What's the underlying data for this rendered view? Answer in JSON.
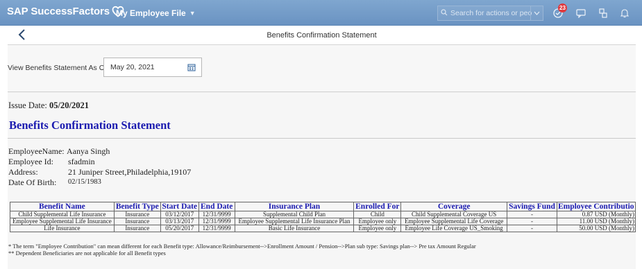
{
  "shell": {
    "brand": "SAP SuccessFactors",
    "module": "My Employee File",
    "search_placeholder": "Search for actions or peo...",
    "notification_count": "23"
  },
  "subheader": {
    "title": "Benefits Confirmation Statement"
  },
  "asof": {
    "label": "View Benefits Statement As Of:",
    "value": "May 20, 2021"
  },
  "statement": {
    "issue_label": "Issue Date:",
    "issue_date": "05/20/2021",
    "title": "Benefits Confirmation Statement",
    "employee": {
      "name_label": "EmployeeName:",
      "name": "Aanya Singh",
      "id_label": "Employee Id:",
      "id": "sfadmin",
      "address_label": "Address:",
      "address": "21 Juniper Street,Philadelphia,19107",
      "dob_label": "Date Of Birth:",
      "dob": "02/15/1983"
    },
    "table": {
      "headers": [
        "Benefit Name",
        "Benefit Type",
        "Start Date",
        "End Date",
        "Insurance Plan",
        "Enrolled For",
        "Coverage",
        "Savings Fund",
        "Employee Contributio"
      ],
      "rows": [
        [
          "Child Supplemental Life Insurance",
          "Insurance",
          "03/12/2017",
          "12/31/9999",
          "Supplemental Child Plan",
          "Child",
          "Child Supplemental Coverage US",
          "-",
          "0.87 USD (Monthly)"
        ],
        [
          "Employee Supplemental Life Insurance",
          "Insurance",
          "03/13/2017",
          "12/31/9999",
          "Employee Supplemental Life Insurance Plan",
          "Employee only",
          "Employee Supplemental Life Coverage",
          "-",
          "11.00 USD (Monthly)"
        ],
        [
          "Life Insurance",
          "Insurance",
          "05/20/2017",
          "12/31/9999",
          "Basic Life Insurance",
          "Employee only",
          "Employee Life Coverage US_Smoking",
          "-",
          "50.00 USD (Monthly)"
        ]
      ]
    },
    "notes": [
      "* The term \"Employee Contribution\" can mean different for each Benefit type: Allowance/Reimbursement-->Enrollment Amount / Pension-->Plan sub type: Savings plan--> Pre tax Amount Regular",
      "** Dependent Beneficiaries are not applicable for all Benefit types"
    ]
  }
}
